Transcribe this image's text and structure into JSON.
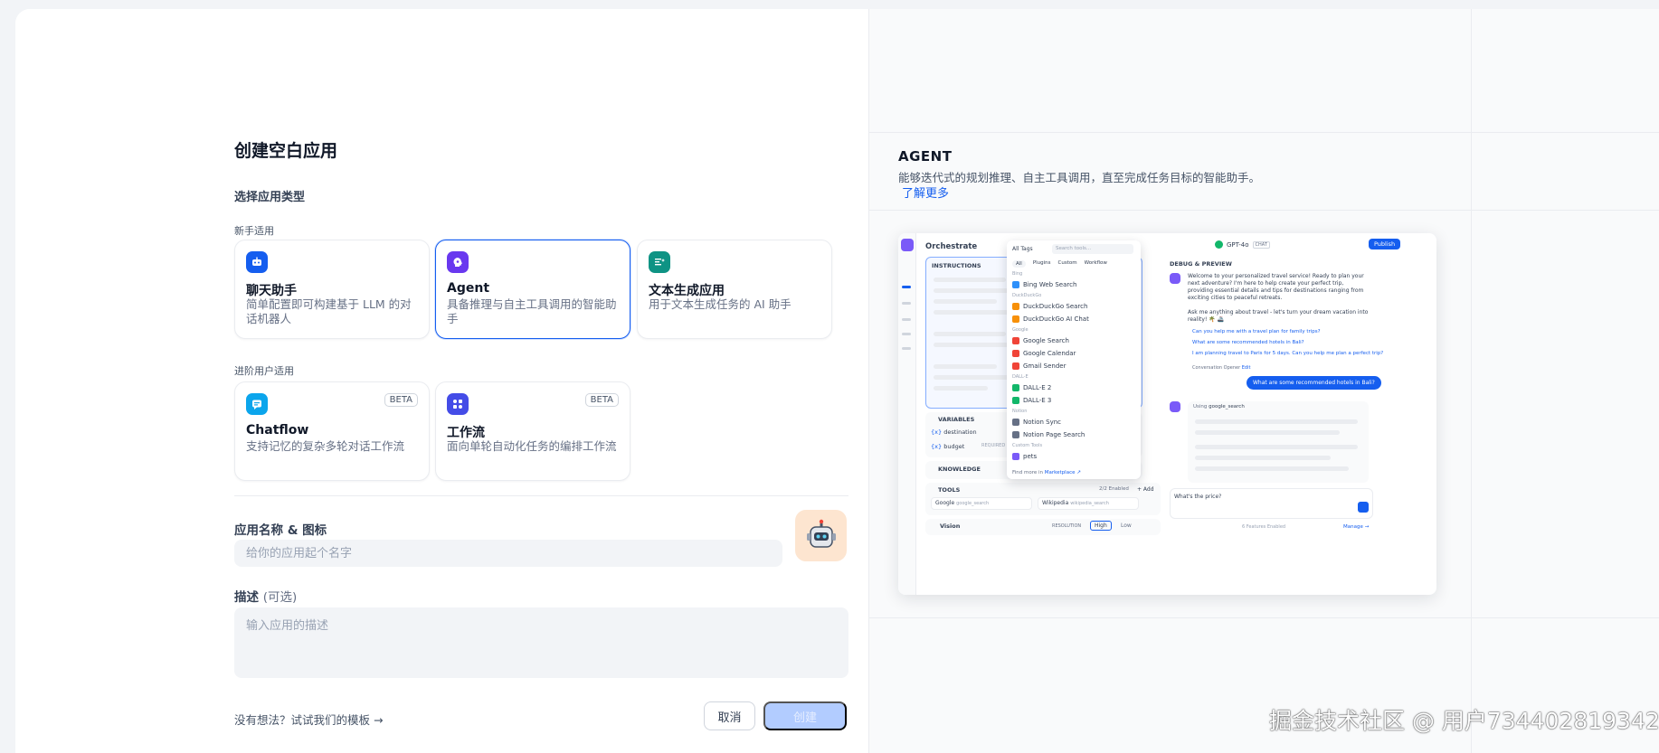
{
  "page_title": "创建空白应用",
  "section_type": "选择应用类型",
  "group_beginner": "新手适用",
  "group_advanced": "进阶用户适用",
  "cards": [
    {
      "title": "聊天助手",
      "desc": "简单配置即可构建基于 LLM 的对话机器人",
      "color": "#155eef"
    },
    {
      "title": "Agent",
      "desc": "具备推理与自主工具调用的智能助手",
      "color": "#6938ef",
      "selected": true
    },
    {
      "title": "文本生成应用",
      "desc": "用于文本生成任务的 AI 助手",
      "color": "#0e9384"
    },
    {
      "title": "Chatflow",
      "desc": "支持记忆的复杂多轮对话工作流",
      "color": "#0ba5ec",
      "badge": "BETA"
    },
    {
      "title": "工作流",
      "desc": "面向单轮自动化任务的编排工作流",
      "color": "#444ce7",
      "badge": "BETA"
    }
  ],
  "name_label": "应用名称 & 图标",
  "name_placeholder": "给你的应用起个名字",
  "desc_label": "描述",
  "desc_optional": "(可选)",
  "desc_placeholder": "输入应用的描述",
  "template_link": "没有想法？试试我们的模板 →",
  "cancel_label": "取消",
  "create_label": "创建",
  "right": {
    "heading": "AGENT",
    "description": "能够迭代式的规划推理、自主工具调用，直至完成任务目标的智能助手。",
    "learn_more": "了解更多"
  },
  "preview": {
    "orchestrate": "Orchestrate",
    "instructions": "INSTRUCTIONS",
    "model": "GPT-4o",
    "model_tag": "CHAT",
    "publish": "Publish",
    "debug": "DEBUG & PREVIEW",
    "all_tags": "All Tags",
    "search_tools": "Search tools...",
    "tabs": [
      "All",
      "Plugins",
      "Custom",
      "Workflow"
    ],
    "groups": [
      {
        "name": "Bing",
        "items": [
          "Bing Web Search"
        ]
      },
      {
        "name": "DuckDuckGo",
        "items": [
          "DuckDuckGo Search",
          "DuckDuckGo AI Chat"
        ]
      },
      {
        "name": "Google",
        "items": [
          "Google Search",
          "Google Calendar",
          "Gmail Sender"
        ]
      },
      {
        "name": "DALL-E",
        "items": [
          "DALL-E 2",
          "DALL-E 3"
        ]
      },
      {
        "name": "Notion",
        "items": [
          "Notion Sync",
          "Notion Page Search"
        ]
      },
      {
        "name": "Custom Tools",
        "items": [
          "pets"
        ]
      }
    ],
    "find_more": "Find more in",
    "marketplace": "Marketplace ↗",
    "variables": "VARIABLES",
    "var1": "destination",
    "var2": "budget",
    "required": "REQUIRED",
    "knowledge": "KNOWLEDGE",
    "tools": "TOOLS",
    "tools_enabled": "2/2 Enabled",
    "add": "+ Add",
    "tool1": "Google",
    "tool1_id": "google_search",
    "tool2": "Wikipedia",
    "tool2_id": "wikipedia_search",
    "vision": "Vision",
    "resolution": "RESOLUTION",
    "high": "High",
    "low": "Low",
    "welcome": "Welcome to your personalized travel service! Ready to plan your next adventure? I'm here to help create your perfect trip, providing essential details and tips for destinations ranging from exciting cities to peaceful retreats.",
    "ask": "Ask me anything about travel - let's turn your dream vacation into reality! 🌴 🚢",
    "sugg1": "Can you help me with a travel plan for family trips?",
    "sugg2": "What are some recommended hotels in Bali?",
    "sugg3": "I am planning travel to Paris for 5 days. Can you help me plan a perfect trip?",
    "opener": "Conversation Opener",
    "edit": "Edit",
    "user_msg": "What are some recommended hotels in Bali?",
    "using": "Using",
    "using_tool": "google_search",
    "chat_input": "What's the price?",
    "features": "6 Features Enabled",
    "manage": "Manage →"
  },
  "watermark": "掘金技术社区 @ 用户734402819342"
}
